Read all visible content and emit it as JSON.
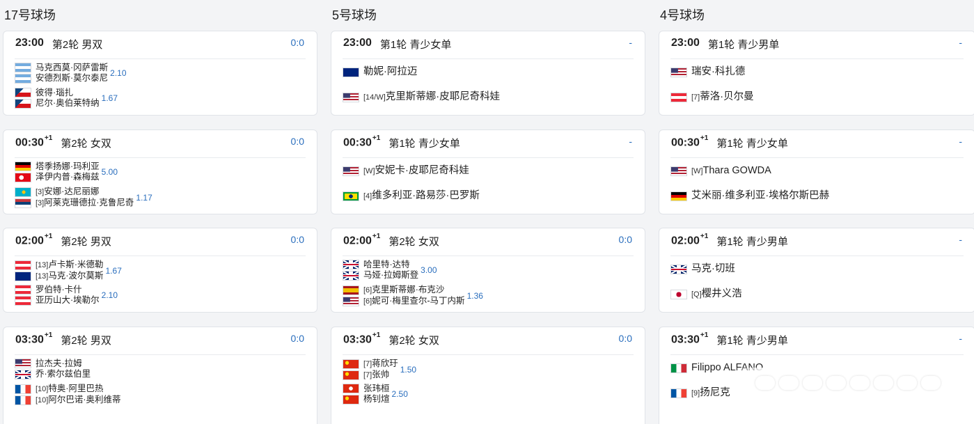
{
  "courts": [
    {
      "title": "17号球场",
      "matches": [
        {
          "time": "23:00",
          "plus": "",
          "round": "第2轮 男双",
          "score": "0:0",
          "teams": [
            {
              "flags": [
                "arg",
                "arg"
              ],
              "seed": [
                "",
                ""
              ],
              "names": [
                "马克西莫·冈萨雷斯",
                "安德烈斯·莫尔泰尼"
              ],
              "odds": "2.10"
            },
            {
              "flags": [
                "cze",
                "cze"
              ],
              "seed": [
                "",
                ""
              ],
              "names": [
                "彼得·瑙扎",
                "尼尔·奥伯莱特纳"
              ],
              "odds": "1.67"
            }
          ]
        },
        {
          "time": "00:30",
          "plus": "+1",
          "round": "第2轮 女双",
          "score": "0:0",
          "teams": [
            {
              "flags": [
                "ger",
                "tur"
              ],
              "seed": [
                "",
                ""
              ],
              "names": [
                "塔季扬娜·玛利亚",
                "泽伊内普·森梅兹"
              ],
              "odds": "5.00"
            },
            {
              "flags": [
                "kaz",
                "srb"
              ],
              "seed": [
                "[3]",
                "[3]"
              ],
              "names": [
                "安娜·达尼丽娜",
                "阿莱克珊德拉·克鲁尼奇"
              ],
              "odds": "1.17"
            }
          ]
        },
        {
          "time": "02:00",
          "plus": "+1",
          "round": "第2轮 男双",
          "score": "0:0",
          "teams": [
            {
              "flags": [
                "aut",
                "aus"
              ],
              "seed": [
                "[13]",
                "[13]"
              ],
              "names": [
                "卢卡斯·米德勒",
                "马克·波尔莫斯"
              ],
              "odds": "1.67"
            },
            {
              "flags": [
                "aut",
                "aut"
              ],
              "seed": [
                "",
                ""
              ],
              "names": [
                "罗伯特·卡什",
                "亚历山大·埃勒尔"
              ],
              "odds": "2.10"
            }
          ]
        },
        {
          "time": "03:30",
          "plus": "+1",
          "round": "第2轮 男双",
          "score": "0:0",
          "teams": [
            {
              "flags": [
                "usa",
                "gbr"
              ],
              "seed": [
                "",
                ""
              ],
              "names": [
                "拉杰夫·拉姆",
                "乔·索尔兹伯里"
              ],
              "odds": ""
            },
            {
              "flags": [
                "fra",
                "fra"
              ],
              "seed": [
                "[10]",
                "[10]"
              ],
              "names": [
                "特奥·阿里巴热",
                "阿尔巴诺·奥利维蒂"
              ],
              "odds": ""
            }
          ]
        }
      ]
    },
    {
      "title": "5号球场",
      "matches": [
        {
          "time": "23:00",
          "plus": "",
          "round": "第1轮 青少女单",
          "score": "-",
          "teams": [
            {
              "flags": [
                "aus"
              ],
              "seed": [
                ""
              ],
              "names": [
                "勒妮·阿拉迈"
              ],
              "odds": ""
            },
            {
              "flags": [
                "usa"
              ],
              "seed": [
                "[14/W]"
              ],
              "names": [
                "克里斯蒂娜·皮耶尼奇科娃"
              ],
              "odds": ""
            }
          ]
        },
        {
          "time": "00:30",
          "plus": "+1",
          "round": "第1轮 青少女单",
          "score": "-",
          "teams": [
            {
              "flags": [
                "usa"
              ],
              "seed": [
                "[W]"
              ],
              "names": [
                "安妮卡·皮耶尼奇科娃"
              ],
              "odds": ""
            },
            {
              "flags": [
                "bra"
              ],
              "seed": [
                "[4]"
              ],
              "names": [
                "维多利亚·路易莎·巴罗斯"
              ],
              "odds": ""
            }
          ]
        },
        {
          "time": "02:00",
          "plus": "+1",
          "round": "第2轮 女双",
          "score": "0:0",
          "teams": [
            {
              "flags": [
                "gbr",
                "gbr"
              ],
              "seed": [
                "",
                ""
              ],
              "names": [
                "哈里特·达特",
                "马娅·拉姆斯登"
              ],
              "odds": "3.00"
            },
            {
              "flags": [
                "esp",
                "usa"
              ],
              "seed": [
                "[6]",
                "[6]"
              ],
              "names": [
                "克里斯蒂娜·布克沙",
                "妮可·梅里查尔-马丁内斯"
              ],
              "odds": "1.36"
            }
          ]
        },
        {
          "time": "03:30",
          "plus": "+1",
          "round": "第2轮 女双",
          "score": "0:0",
          "teams": [
            {
              "flags": [
                "chn",
                "chn"
              ],
              "seed": [
                "[7]",
                "[7]"
              ],
              "names": [
                "蒋欣玗",
                "张帅"
              ],
              "odds": "1.50"
            },
            {
              "flags": [
                "hkg",
                "chn"
              ],
              "seed": [
                "",
                ""
              ],
              "names": [
                "张玮桓",
                "杨钊煊"
              ],
              "odds": "2.50"
            }
          ]
        }
      ]
    },
    {
      "title": "4号球场",
      "matches": [
        {
          "time": "23:00",
          "plus": "",
          "round": "第1轮 青少男单",
          "score": "-",
          "teams": [
            {
              "flags": [
                "usa"
              ],
              "seed": [
                ""
              ],
              "names": [
                "瑞安·科扎德"
              ],
              "odds": ""
            },
            {
              "flags": [
                "aut"
              ],
              "seed": [
                "[7]"
              ],
              "names": [
                "蒂洛·贝尔曼"
              ],
              "odds": ""
            }
          ]
        },
        {
          "time": "00:30",
          "plus": "+1",
          "round": "第1轮 青少女单",
          "score": "-",
          "teams": [
            {
              "flags": [
                "usa"
              ],
              "seed": [
                "[W]"
              ],
              "names": [
                "Thara GOWDA"
              ],
              "odds": ""
            },
            {
              "flags": [
                "ger"
              ],
              "seed": [
                ""
              ],
              "names": [
                "艾米丽·维多利亚·埃格尔斯巴赫"
              ],
              "odds": ""
            }
          ]
        },
        {
          "time": "02:00",
          "plus": "+1",
          "round": "第1轮 青少男单",
          "score": "-",
          "teams": [
            {
              "flags": [
                "gbr"
              ],
              "seed": [
                ""
              ],
              "names": [
                "马克·切班"
              ],
              "odds": ""
            },
            {
              "flags": [
                "jpn"
              ],
              "seed": [
                "[Q]"
              ],
              "names": [
                "樱井义浩"
              ],
              "odds": ""
            }
          ]
        },
        {
          "time": "03:30",
          "plus": "+1",
          "round": "第1轮 青少男单",
          "score": "-",
          "teams": [
            {
              "flags": [
                "ita"
              ],
              "seed": [
                ""
              ],
              "names": [
                "Filippo ALFANO"
              ],
              "odds": ""
            },
            {
              "flags": [
                "fra"
              ],
              "seed": [
                "[9]"
              ],
              "names": [
                "扬尼克"
              ],
              "odds": ""
            }
          ]
        }
      ]
    }
  ]
}
